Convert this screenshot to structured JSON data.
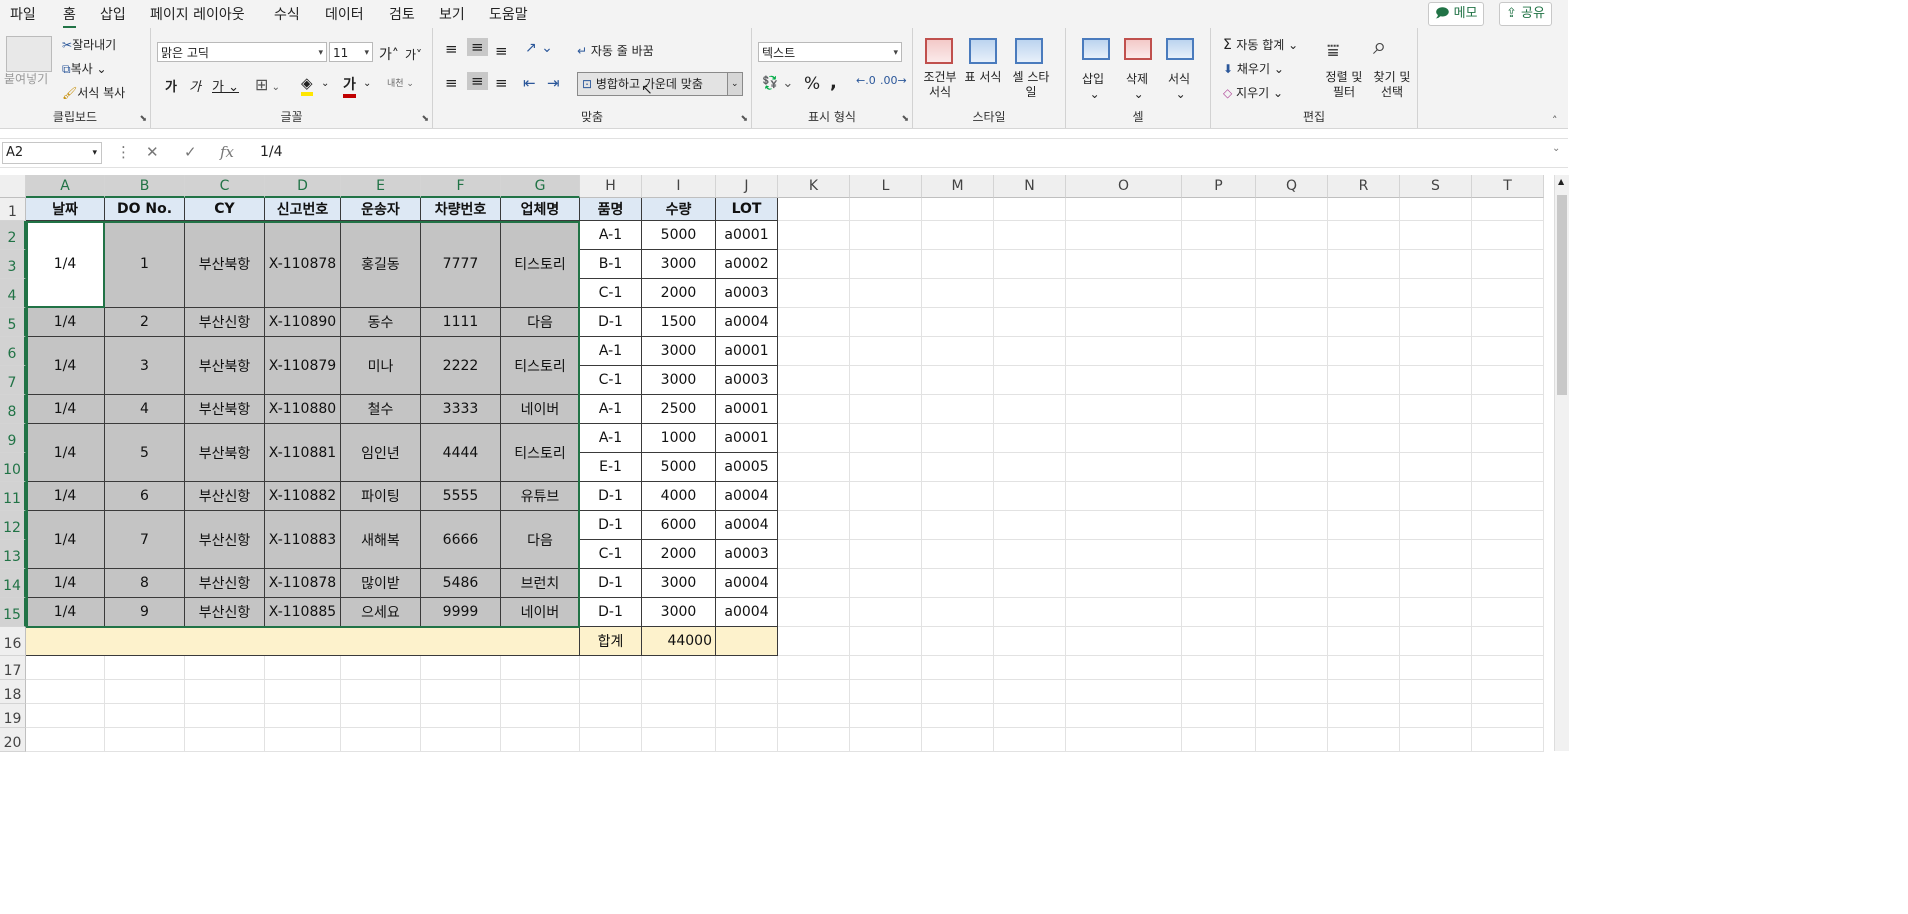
{
  "menu": {
    "tabs": [
      "파일",
      "홈",
      "삽입",
      "페이지 레이아웃",
      "수식",
      "데이터",
      "검토",
      "보기",
      "도움말"
    ],
    "active_tab": "홈",
    "memo_button": "메모",
    "share_button": "공유"
  },
  "ribbon": {
    "clipboard": {
      "label": "클립보드",
      "paste": "붙여넣기",
      "cut": "잘라내기",
      "copy": "복사",
      "format_painter": "서식 복사"
    },
    "font": {
      "label": "글꼴",
      "font_name": "맑은 고딕",
      "font_size": "11",
      "bold": "가",
      "italic": "가",
      "underline": "가",
      "font_color": "가",
      "phonetic": "내천",
      "grow": "가",
      "shrink": "가"
    },
    "alignment": {
      "label": "맞춤",
      "wrap_text": "자동 줄 바꿈",
      "merge_center": "병합하고 가운데 맞춤"
    },
    "number": {
      "label": "표시 형식",
      "format": "텍스트",
      "percent": "%",
      "comma": ","
    },
    "styles": {
      "label": "스타일",
      "conditional": "조건부 서식",
      "table": "표 서식",
      "cell_style": "셀 스타일"
    },
    "cells": {
      "label": "셀",
      "insert": "삽입",
      "delete": "삭제",
      "format": "서식"
    },
    "editing": {
      "label": "편집",
      "autosum": "자동 합계",
      "fill": "채우기",
      "clear": "지우기",
      "sort_filter": "정렬 및 필터",
      "find_select": "찾기 및 선택"
    }
  },
  "formula_bar": {
    "name_box": "A2",
    "cancel": "✕",
    "enter": "✓",
    "fx": "fx",
    "value": "1/4"
  },
  "columns": [
    "A",
    "B",
    "C",
    "D",
    "E",
    "F",
    "G",
    "H",
    "I",
    "J",
    "K",
    "L",
    "M",
    "N",
    "O",
    "P",
    "Q",
    "R",
    "S",
    "T"
  ],
  "rows": [
    "1",
    "2",
    "3",
    "4",
    "5",
    "6",
    "7",
    "8",
    "9",
    "10",
    "11",
    "12",
    "13",
    "14",
    "15",
    "16",
    "17",
    "18",
    "19",
    "20"
  ],
  "table": {
    "headers": [
      "날짜",
      "DO No.",
      "CY",
      "신고번호",
      "운송자",
      "차량번호",
      "업체명",
      "품명",
      "수량",
      "LOT"
    ],
    "groups": [
      {
        "date": "1/4",
        "do": "1",
        "cy": "부산북항",
        "decl": "X-110878",
        "carrier": "홍길동",
        "vehicle": "7777",
        "company": "티스토리"
      },
      {
        "date": "1/4",
        "do": "2",
        "cy": "부산신항",
        "decl": "X-110890",
        "carrier": "동수",
        "vehicle": "1111",
        "company": "다음"
      },
      {
        "date": "1/4",
        "do": "3",
        "cy": "부산북항",
        "decl": "X-110879",
        "carrier": "미나",
        "vehicle": "2222",
        "company": "티스토리"
      },
      {
        "date": "1/4",
        "do": "4",
        "cy": "부산북항",
        "decl": "X-110880",
        "carrier": "철수",
        "vehicle": "3333",
        "company": "네이버"
      },
      {
        "date": "1/4",
        "do": "5",
        "cy": "부산북항",
        "decl": "X-110881",
        "carrier": "임인년",
        "vehicle": "4444",
        "company": "티스토리"
      },
      {
        "date": "1/4",
        "do": "6",
        "cy": "부산신항",
        "decl": "X-110882",
        "carrier": "파이팅",
        "vehicle": "5555",
        "company": "유튜브"
      },
      {
        "date": "1/4",
        "do": "7",
        "cy": "부산신항",
        "decl": "X-110883",
        "carrier": "새해복",
        "vehicle": "6666",
        "company": "다음"
      },
      {
        "date": "1/4",
        "do": "8",
        "cy": "부산신항",
        "decl": "X-110878",
        "carrier": "많이받",
        "vehicle": "5486",
        "company": "브런치"
      },
      {
        "date": "1/4",
        "do": "9",
        "cy": "부산신항",
        "decl": "X-110885",
        "carrier": "으세요",
        "vehicle": "9999",
        "company": "네이버"
      }
    ],
    "items": [
      {
        "product": "A-1",
        "qty": "5000",
        "lot": "a0001"
      },
      {
        "product": "B-1",
        "qty": "3000",
        "lot": "a0002"
      },
      {
        "product": "C-1",
        "qty": "2000",
        "lot": "a0003"
      },
      {
        "product": "D-1",
        "qty": "1500",
        "lot": "a0004"
      },
      {
        "product": "A-1",
        "qty": "3000",
        "lot": "a0001"
      },
      {
        "product": "C-1",
        "qty": "3000",
        "lot": "a0003"
      },
      {
        "product": "A-1",
        "qty": "2500",
        "lot": "a0001"
      },
      {
        "product": "A-1",
        "qty": "1000",
        "lot": "a0001"
      },
      {
        "product": "E-1",
        "qty": "5000",
        "lot": "a0005"
      },
      {
        "product": "D-1",
        "qty": "4000",
        "lot": "a0004"
      },
      {
        "product": "D-1",
        "qty": "6000",
        "lot": "a0004"
      },
      {
        "product": "C-1",
        "qty": "2000",
        "lot": "a0003"
      },
      {
        "product": "D-1",
        "qty": "3000",
        "lot": "a0004"
      },
      {
        "product": "D-1",
        "qty": "3000",
        "lot": "a0004"
      }
    ],
    "total_label": "합계",
    "total_value": "44000"
  },
  "colors": {
    "accent": "#217346",
    "header_fill": "#dde8f4",
    "merged_fill": "#c4c4c4",
    "total_fill": "#fdf2cc"
  }
}
